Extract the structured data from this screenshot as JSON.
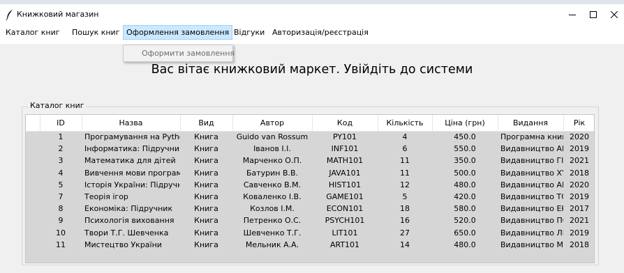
{
  "window": {
    "title": "Книжковий магазин"
  },
  "menu": [
    "Каталог книг",
    "Пошук книг",
    "Оформлення замовлення",
    "Відгуки",
    "Авторизація/реєстрація"
  ],
  "dropdown": {
    "item": "Оформити замовлення"
  },
  "welcome": "Вас вітає книжковий маркет. Увійдіть до системи",
  "catalog": {
    "label": "Каталог книг",
    "columns": [
      "ID",
      "Назва",
      "Вид",
      "Автор",
      "Код",
      "Кількість",
      "Ціна (грн)",
      "Видання",
      "Рік"
    ],
    "rows": [
      [
        "1",
        "Програмування на Python",
        "Книга",
        "Guido van Rossum",
        "PY101",
        "4",
        "450.0",
        "Програмна книга",
        "2020"
      ],
      [
        "2",
        "Інформатика: Підручник",
        "Книга",
        "Іванов І.І.",
        "INF101",
        "6",
        "550.0",
        "Видавництво АБВ",
        "2019"
      ],
      [
        "3",
        "Математика для дітей",
        "Книга",
        "Марченко О.П.",
        "MATH101",
        "11",
        "350.0",
        "Видавництво ГІМ",
        "2021"
      ],
      [
        "4",
        "Вивчення мови програму",
        "Книга",
        "Батурин В.В.",
        "JAVA101",
        "11",
        "500.0",
        "Видавництво XYZ",
        "2018"
      ],
      [
        "5",
        "Історія України: Підручни",
        "Книга",
        "Савченко В.М.",
        "HIST101",
        "12",
        "480.0",
        "Видавництво АВС",
        "2020"
      ],
      [
        "7",
        "Теорія ігор",
        "Книга",
        "Коваленко І.В.",
        "GAME101",
        "5",
        "420.0",
        "Видавництво ТОП",
        "2019"
      ],
      [
        "8",
        "Економіка: Підручник",
        "Книга",
        "Козлов І.М.",
        "ECON101",
        "18",
        "580.0",
        "Видавництво ЕКО",
        "2017"
      ],
      [
        "9",
        "Психологія виховання",
        "Книга",
        "Петренко О.С.",
        "PSYCH101",
        "16",
        "520.0",
        "Видавництво ПС",
        "2021"
      ],
      [
        "10",
        "Твори Т.Г. Шевченка",
        "Книга",
        "Шевченко Т.Г.",
        "LIT101",
        "27",
        "650.0",
        "Видавництво ЛІТ",
        "2019"
      ],
      [
        "11",
        "Мистецтво України",
        "Книга",
        "Мельник А.А.",
        "ART101",
        "14",
        "480.0",
        "Видавництво МИ",
        "2018"
      ]
    ]
  }
}
